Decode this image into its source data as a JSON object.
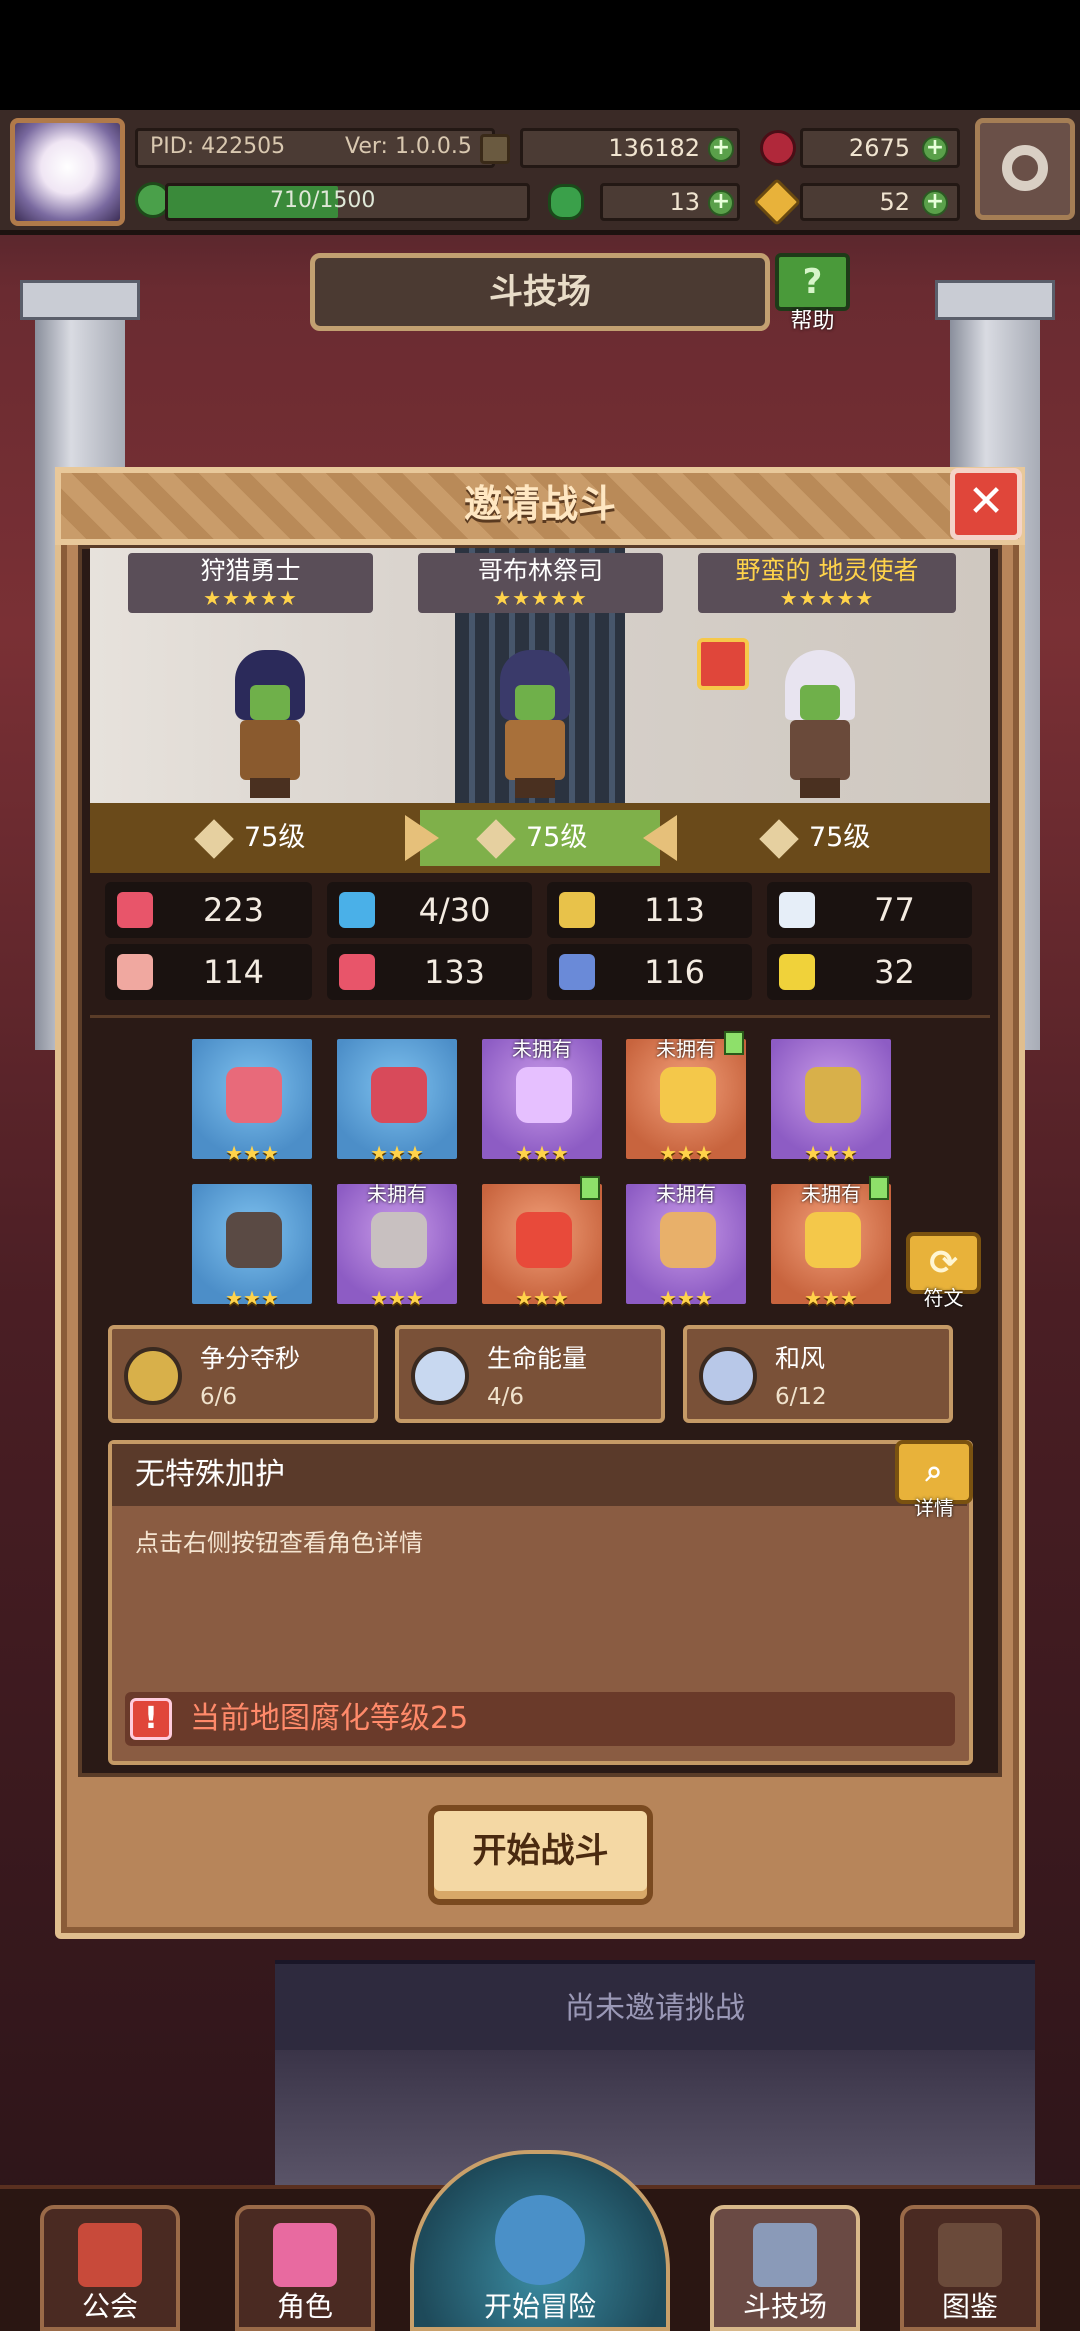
{
  "topbar": {
    "pid": "PID: 422505",
    "version": "Ver: 1.0.0.5",
    "gold": "136182",
    "gems": "2675",
    "exp": "710/1500",
    "exp_progress": 0.473,
    "clover": "13",
    "keys": "52"
  },
  "arena": {
    "title": "斗技场",
    "help_label": "帮助"
  },
  "modal": {
    "title": "邀请战斗",
    "close_label": "✕",
    "heroes": [
      {
        "name": "狩猎勇士",
        "stars": "★★★★★",
        "level": "75级"
      },
      {
        "name": "哥布林祭司",
        "stars": "★★★★★",
        "level": "75级"
      },
      {
        "name": "野蛮的 地灵使者",
        "stars": "★★★★★",
        "level": "75级"
      }
    ],
    "stats": [
      {
        "icon": "heart-icon",
        "value": "223",
        "color": "#e8556a"
      },
      {
        "icon": "mana-drop-icon",
        "value": "4/30",
        "color": "#4ab0e8"
      },
      {
        "icon": "shield-icon",
        "value": "113",
        "color": "#e8c24a"
      },
      {
        "icon": "wing-icon",
        "value": "77",
        "color": "#e6eef8"
      },
      {
        "icon": "fist-icon",
        "value": "114",
        "color": "#f0a8a0"
      },
      {
        "icon": "spellbook-icon",
        "value": "133",
        "color": "#e8556a"
      },
      {
        "icon": "scroll-icon",
        "value": "116",
        "color": "#6a8ad8"
      },
      {
        "icon": "horseshoe-icon",
        "value": "32",
        "color": "#f0d23a"
      }
    ],
    "equipment": [
      {
        "icon": "wand-icon",
        "stars": "★★★",
        "owned": "",
        "upgrade": false,
        "rarity": "blue",
        "color": "#e86a7a"
      },
      {
        "icon": "heart-shield-icon",
        "stars": "★★★",
        "owned": "",
        "upgrade": false,
        "rarity": "blue",
        "color": "#d84a5a"
      },
      {
        "icon": "necklace-icon",
        "stars": "★★★",
        "owned": "未拥有",
        "upgrade": false,
        "rarity": "purple",
        "color": "#e6c0ff"
      },
      {
        "icon": "gold-emblem-icon",
        "stars": "★★★",
        "owned": "未拥有",
        "upgrade": true,
        "rarity": "orange",
        "color": "#f4c84a"
      },
      {
        "icon": "ring-icon",
        "stars": "★★★",
        "owned": "",
        "upgrade": false,
        "rarity": "purple",
        "color": "#d8b04a"
      },
      {
        "icon": "hood-icon",
        "stars": "★★★",
        "owned": "",
        "upgrade": false,
        "rarity": "blue",
        "color": "#5a4a44"
      },
      {
        "icon": "fur-armor-icon",
        "stars": "★★★",
        "owned": "未拥有",
        "upgrade": false,
        "rarity": "purple",
        "color": "#c8c0c0"
      },
      {
        "icon": "gauntlet-icon",
        "stars": "★★★",
        "owned": "",
        "upgrade": true,
        "rarity": "orange",
        "color": "#e84a3a"
      },
      {
        "icon": "jester-armor-icon",
        "stars": "★★★",
        "owned": "未拥有",
        "upgrade": false,
        "rarity": "purple",
        "color": "#e8b06a"
      },
      {
        "icon": "gold-boots-icon",
        "stars": "★★★",
        "owned": "未拥有",
        "upgrade": true,
        "rarity": "orange",
        "color": "#f4c84a"
      }
    ],
    "rune_label": "符文",
    "traits": [
      {
        "name": "争分夺秒",
        "count": "6/6",
        "color": "#d8b04a"
      },
      {
        "name": "生命能量",
        "count": "4/6",
        "color": "#c8d8f0"
      },
      {
        "name": "和风",
        "count": "6/12",
        "color": "#b8c8e8"
      }
    ],
    "info": {
      "title": "无特殊加护",
      "body": "点击右侧按钮查看角色详情",
      "detail_label": "详情",
      "warning": "当前地图腐化等级25"
    },
    "start_button": "开始战斗"
  },
  "background": {
    "no_invite": "尚未邀请挑战"
  },
  "nav": [
    {
      "label": "公会",
      "color": "#c84a3a"
    },
    {
      "label": "角色",
      "color": "#e86aa0"
    },
    {
      "label": "开始冒险",
      "color": "#4a90c8"
    },
    {
      "label": "斗技场",
      "color": "#8a9ab8"
    },
    {
      "label": "图鉴",
      "color": "#6a4a3a"
    }
  ]
}
